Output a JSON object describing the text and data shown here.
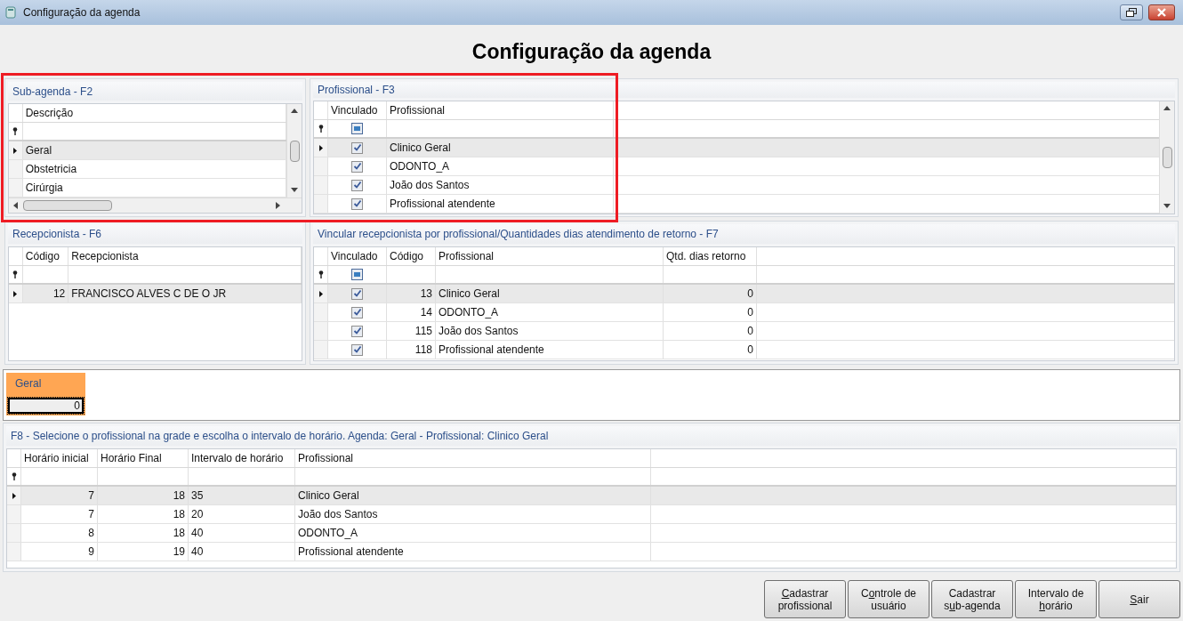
{
  "window": {
    "title": "Configuração da agenda"
  },
  "heading": "Configuração da agenda",
  "sub_agenda": {
    "title": "Sub-agenda - F2",
    "columns": [
      {
        "label": "Descrição",
        "kind": "text"
      }
    ],
    "rows": [
      {
        "selected": true,
        "cells": [
          "Geral"
        ]
      },
      {
        "selected": false,
        "cells": [
          "Obstetricia"
        ]
      },
      {
        "selected": false,
        "cells": [
          "Cirúrgia"
        ]
      }
    ]
  },
  "profissional": {
    "title": "Profissional - F3",
    "columns": [
      {
        "label": "Vinculado",
        "kind": "check"
      },
      {
        "label": "Profissional",
        "kind": "text"
      }
    ],
    "rows": [
      {
        "selected": true,
        "cells": [
          true,
          "Clinico Geral"
        ]
      },
      {
        "selected": false,
        "cells": [
          true,
          "ODONTO_A"
        ]
      },
      {
        "selected": false,
        "cells": [
          true,
          "João dos Santos"
        ]
      },
      {
        "selected": false,
        "cells": [
          true,
          "Profissional atendente"
        ]
      }
    ]
  },
  "recepcionista": {
    "title": "Recepcionista - F6",
    "columns": [
      {
        "label": "Código",
        "kind": "number"
      },
      {
        "label": "Recepcionista",
        "kind": "text"
      }
    ],
    "rows": [
      {
        "selected": true,
        "cells": [
          "12",
          "FRANCISCO ALVES C DE O JR"
        ]
      }
    ]
  },
  "vincular": {
    "title": "Vincular recepcionista por profissional/Quantidades dias atendimento de retorno - F7",
    "columns": [
      {
        "label": "Vinculado",
        "kind": "check"
      },
      {
        "label": "Código",
        "kind": "number"
      },
      {
        "label": "Profissional",
        "kind": "text"
      },
      {
        "label": "Qtd. dias retorno",
        "kind": "number"
      }
    ],
    "rows": [
      {
        "selected": true,
        "cells": [
          true,
          "13",
          "Clinico Geral",
          "0"
        ]
      },
      {
        "selected": false,
        "cells": [
          true,
          "14",
          "ODONTO_A",
          "0"
        ]
      },
      {
        "selected": false,
        "cells": [
          true,
          "115",
          "João dos Santos",
          "0"
        ]
      },
      {
        "selected": false,
        "cells": [
          true,
          "118",
          "Profissional atendente",
          "0"
        ]
      }
    ]
  },
  "agenda_tab": {
    "label": "Geral",
    "value": "0"
  },
  "horarios": {
    "title": "F8 - Selecione o profissional na grade e escolha o intervalo de horário. Agenda: Geral - Profissional: Clinico Geral",
    "columns": [
      {
        "label": "Horário inicial",
        "kind": "number"
      },
      {
        "label": "Horário Final",
        "kind": "number"
      },
      {
        "label": "Intervalo de horário",
        "kind": "text"
      },
      {
        "label": "Profissional",
        "kind": "text"
      }
    ],
    "rows": [
      {
        "selected": true,
        "cells": [
          "7",
          "18",
          "35",
          "Clinico Geral"
        ]
      },
      {
        "selected": false,
        "cells": [
          "7",
          "18",
          "20",
          "João dos Santos"
        ]
      },
      {
        "selected": false,
        "cells": [
          "8",
          "18",
          "40",
          "ODONTO_A"
        ]
      },
      {
        "selected": false,
        "cells": [
          "9",
          "19",
          "40",
          "Profissional atendente"
        ]
      }
    ]
  },
  "buttons": [
    {
      "key": "C",
      "post": "adastrar\nprofissional"
    },
    {
      "pre": "C",
      "key": "o",
      "post": "ntrole de\nusuário"
    },
    {
      "pre": "Cadastrar\ns",
      "key": "u",
      "post": "b-agenda"
    },
    {
      "pre": "Intervalo de\n",
      "key": "h",
      "post": "orário"
    },
    {
      "key": "S",
      "post": "air"
    }
  ]
}
